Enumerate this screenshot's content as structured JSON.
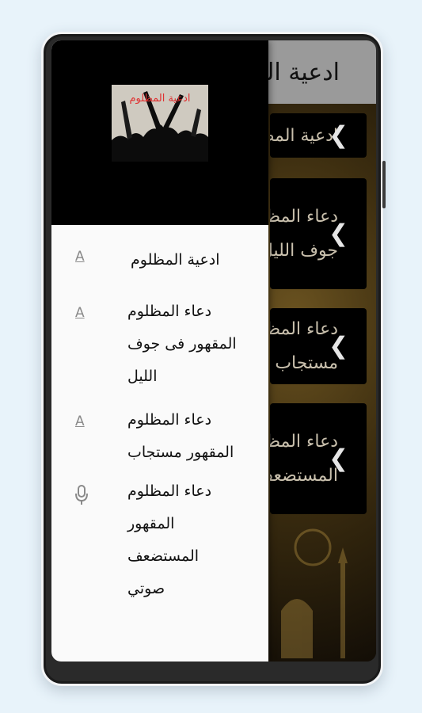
{
  "app": {
    "title": "ادعية المظلوم"
  },
  "cards": [
    {
      "text": "ادعية المظلوم"
    },
    {
      "text": "دعاء المظلوم المقهور فى جوف الليل"
    },
    {
      "text": "دعاء المظلوم المقهور مستجاب"
    },
    {
      "text": "دعاء المظلوم المقهور المستضعف صوتي"
    }
  ],
  "drawer": {
    "logo_text": "ادعية المظلوم",
    "items": [
      {
        "label": "ادعية المظلوم",
        "icon": "text-a-icon"
      },
      {
        "label": "دعاء المظلوم المقهور فى جوف الليل",
        "icon": "text-a-icon"
      },
      {
        "label": "دعاء المظلوم المقهور مستجاب",
        "icon": "text-a-icon"
      },
      {
        "label": "دعاء المظلوم المقهور المستضعف صوتي",
        "icon": "microphone-icon"
      }
    ]
  },
  "colors": {
    "page_bg": "#e8f3fa",
    "drawer_bg": "#fafafa",
    "header_gray": "#9a9a9a",
    "logo_red": "#e03030"
  }
}
